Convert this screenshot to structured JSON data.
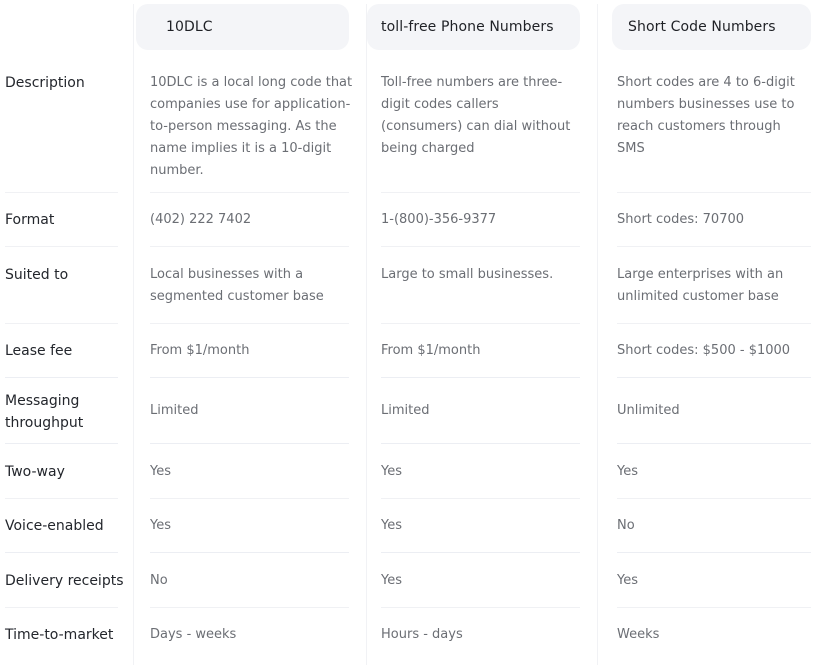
{
  "columns": [
    {
      "title": "10DLC"
    },
    {
      "title": "toll-free Phone Numbers"
    },
    {
      "title": "Short Code Numbers"
    }
  ],
  "rows": [
    {
      "label": "Description",
      "values": [
        "10DLC is a local long code that companies use for application-to-person messaging. As the name implies it is a 10-digit number.",
        "Toll-free numbers are three-digit codes callers (consumers) can dial without being charged",
        "Short codes are 4 to 6-digit numbers businesses use to reach customers through SMS"
      ]
    },
    {
      "label": "Format",
      "values": [
        "(402) 222 7402",
        "1-(800)-356-9377",
        "Short codes: 70700"
      ]
    },
    {
      "label": "Suited to",
      "values": [
        "Local businesses with a segmented customer base",
        "Large to small businesses.",
        "Large enterprises with an unlimited customer base"
      ]
    },
    {
      "label": "Lease fee",
      "values": [
        "From $1/month",
        "From $1/month",
        "Short codes: $500 - $1000"
      ]
    },
    {
      "label": "Messaging throughput",
      "values": [
        "Limited",
        "Limited",
        "Unlimited"
      ]
    },
    {
      "label": "Two-way",
      "values": [
        "Yes",
        "Yes",
        "Yes"
      ]
    },
    {
      "label": "Voice-enabled",
      "values": [
        "Yes",
        "Yes",
        "No"
      ]
    },
    {
      "label": "Delivery receipts",
      "values": [
        "No",
        "Yes",
        "Yes"
      ]
    },
    {
      "label": "Time-to-market",
      "values": [
        "Days - weeks",
        "Hours - days",
        "Weeks"
      ]
    }
  ]
}
